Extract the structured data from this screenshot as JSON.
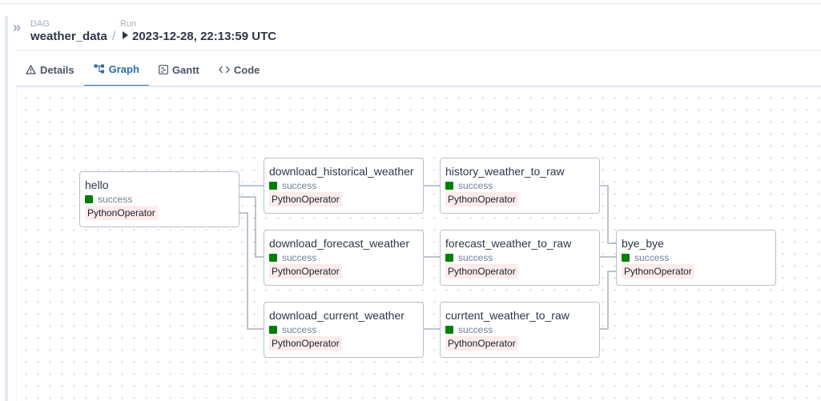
{
  "breadcrumb": {
    "dag_label": "DAG",
    "dag_value": "weather_data",
    "separator": "/",
    "run_label": "Run",
    "run_value": "2023-12-28, 22:13:59 UTC"
  },
  "tabs": [
    {
      "label": "Details",
      "icon": "warning-icon"
    },
    {
      "label": "Graph",
      "icon": "graph-icon"
    },
    {
      "label": "Gantt",
      "icon": "gantt-icon"
    },
    {
      "label": "Code",
      "icon": "code-icon"
    }
  ],
  "active_tab": "Graph",
  "colors": {
    "accent": "#2b6cb0",
    "success": "#008000",
    "operator_bg": "#fdeceb"
  },
  "nodes": [
    {
      "name": "hello",
      "state": "success",
      "operator": "PythonOperator"
    },
    {
      "name": "download_historical_weather",
      "state": "success",
      "operator": "PythonOperator"
    },
    {
      "name": "download_forecast_weather",
      "state": "success",
      "operator": "PythonOperator"
    },
    {
      "name": "download_current_weather",
      "state": "success",
      "operator": "PythonOperator"
    },
    {
      "name": "history_weather_to_raw",
      "state": "success",
      "operator": "PythonOperator"
    },
    {
      "name": "forecast_weather_to_raw",
      "state": "success",
      "operator": "PythonOperator"
    },
    {
      "name": "currtent_weather_to_raw",
      "state": "success",
      "operator": "PythonOperator"
    },
    {
      "name": "bye_bye",
      "state": "success",
      "operator": "PythonOperator"
    }
  ]
}
